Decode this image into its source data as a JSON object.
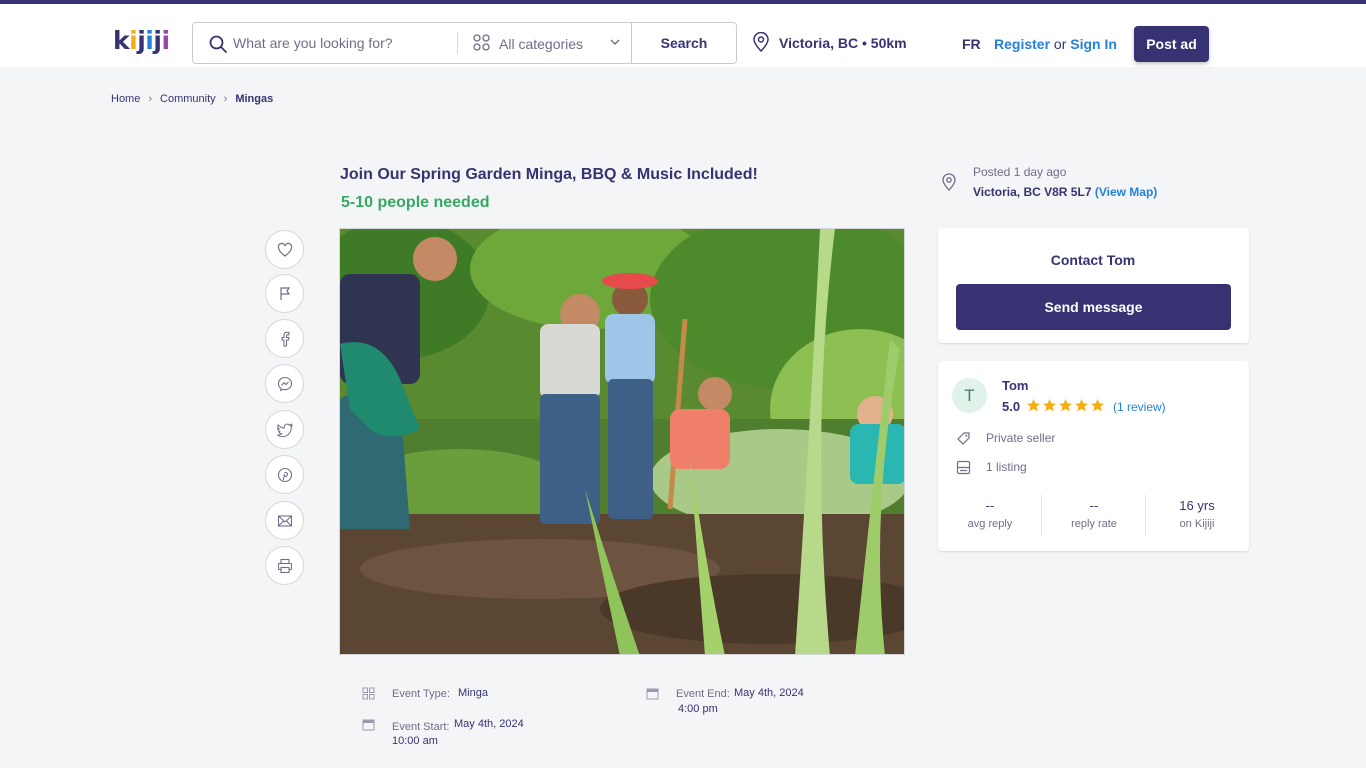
{
  "header": {
    "logo_text": "kijiji",
    "search_placeholder": "What are you looking for?",
    "category_label": "All categories",
    "search_button": "Search",
    "location": "Victoria, BC • 50km",
    "language": "FR",
    "register": "Register",
    "or": "or",
    "sign_in": "Sign In",
    "post_ad": "Post ad",
    "accent_color": "#373373"
  },
  "breadcrumb": {
    "home": "Home",
    "community": "Community",
    "current": "Mingas"
  },
  "ad": {
    "title": "Join Our Spring Garden Minga, BBQ & Music Included!",
    "people_needed": "5-10 people needed",
    "people_color": "#37a864"
  },
  "social_icons": [
    "heart-icon",
    "flag-icon",
    "facebook-icon",
    "messenger-icon",
    "twitter-icon",
    "pinterest-icon",
    "email-icon",
    "print-icon"
  ],
  "details": {
    "event_type_label": "Event Type:",
    "event_type": "Minga",
    "event_start_label": "Event Start:",
    "event_start_date": "May 4th, 2024",
    "event_start_time": "10:00 am",
    "event_end_label": "Event End:",
    "event_end_date": "May 4th, 2024",
    "event_end_time": "4:00 pm"
  },
  "listing_info": {
    "posted": "Posted 1 day ago",
    "address": "Victoria, BC V8R 5L7",
    "view_map": "(View Map)"
  },
  "contact": {
    "title": "Contact Tom",
    "send_button": "Send message"
  },
  "seller": {
    "initial": "T",
    "name": "Tom",
    "rating": "5.0",
    "stars": 5,
    "reviews": "(1 review)",
    "type": "Private seller",
    "listings": "1 listing",
    "stats": [
      {
        "value": "--",
        "label": "avg reply"
      },
      {
        "value": "--",
        "label": "reply rate"
      },
      {
        "value": "16 yrs",
        "label": "on Kijiji"
      }
    ]
  }
}
